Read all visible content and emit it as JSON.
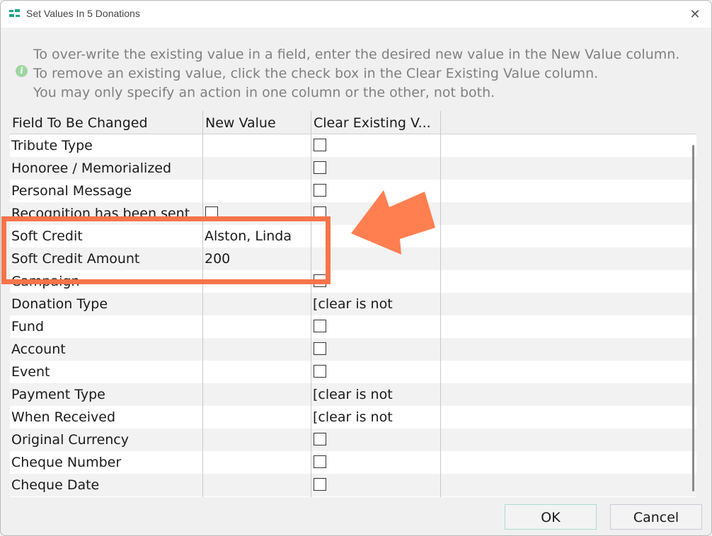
{
  "window": {
    "title": "Set Values In 5 Donations",
    "close_symbol": "✕"
  },
  "info": {
    "icon": "info-icon",
    "icon_glyph": "i",
    "lines": [
      "To over-write the existing value in a field, enter the desired new value in the New Value column.",
      "To remove an existing value, click the check box in the Clear Existing Value column.",
      "You may only specify an action in one column or the other, not both."
    ]
  },
  "grid": {
    "columns": [
      "Field To Be Changed",
      "New Value",
      "Clear Existing V..."
    ],
    "rows": [
      {
        "field": "Tribute Type",
        "new_value": "",
        "clear": "checkbox"
      },
      {
        "field": "Honoree / Memorialized",
        "new_value": "",
        "clear": "checkbox"
      },
      {
        "field": "Personal Message",
        "new_value": "",
        "clear": "checkbox"
      },
      {
        "field": "Recognition has been sent",
        "new_value": "checkbox",
        "clear": "checkbox"
      },
      {
        "field": "Soft Credit",
        "new_value": "Alston, Linda",
        "clear": ""
      },
      {
        "field": "Soft Credit Amount",
        "new_value": "200",
        "clear": ""
      },
      {
        "field": "Campaign",
        "new_value": "",
        "clear": "checkbox"
      },
      {
        "field": "Donation Type",
        "new_value": "",
        "clear": "[clear is not"
      },
      {
        "field": "Fund",
        "new_value": "",
        "clear": "checkbox"
      },
      {
        "field": "Account",
        "new_value": "",
        "clear": "checkbox"
      },
      {
        "field": "Event",
        "new_value": "",
        "clear": "checkbox"
      },
      {
        "field": "Payment Type",
        "new_value": "",
        "clear": "[clear is not"
      },
      {
        "field": "When Received",
        "new_value": "",
        "clear": "[clear is not"
      },
      {
        "field": "Original Currency",
        "new_value": "",
        "clear": "checkbox"
      },
      {
        "field": "Cheque Number",
        "new_value": "",
        "clear": "checkbox"
      },
      {
        "field": "Cheque Date",
        "new_value": "",
        "clear": "checkbox"
      }
    ]
  },
  "annotation": {
    "highlight_color": "#f7744a",
    "arrow_color": "#ff7f50"
  },
  "buttons": {
    "ok": "OK",
    "cancel": "Cancel"
  }
}
